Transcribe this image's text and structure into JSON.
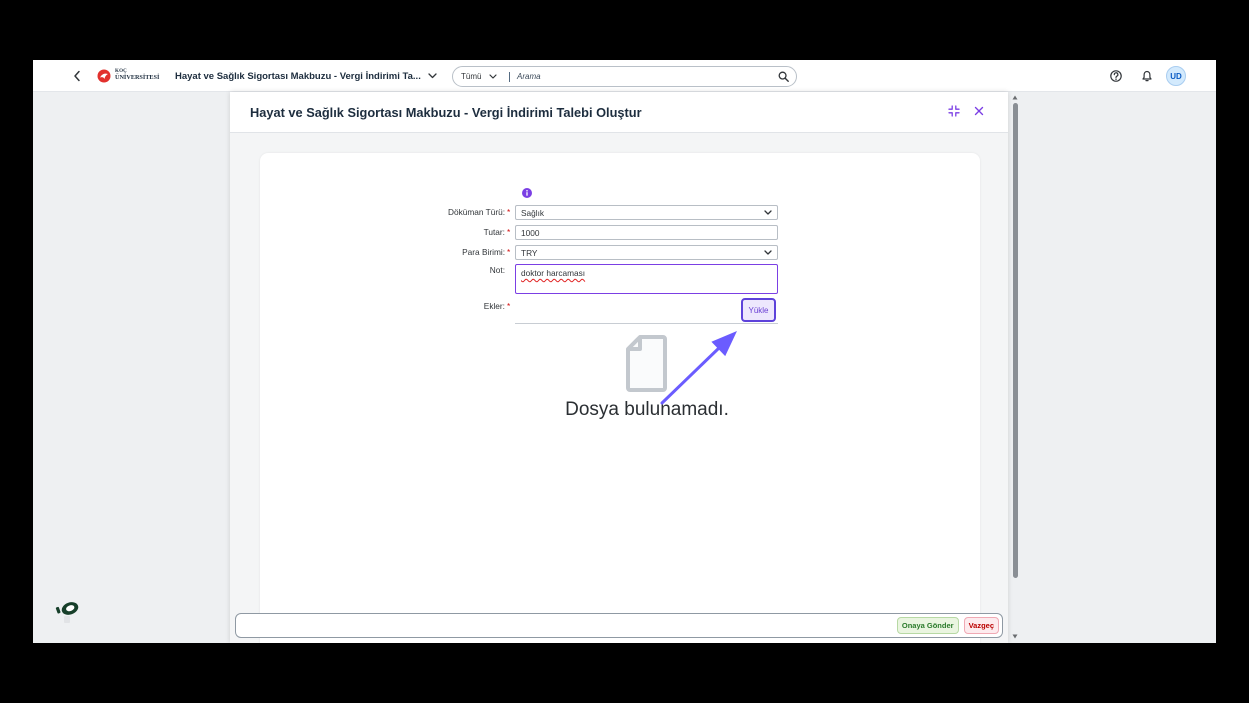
{
  "shell": {
    "logo": {
      "line1": "KOÇ",
      "line2": "ÜNİVERSİTESİ"
    },
    "app_title": "Hayat ve Sağlık Sigortası Makbuzu - Vergi İndirimi Ta...",
    "search": {
      "scope": "Tümü",
      "placeholder": "Arama"
    },
    "user_initials": "UD",
    "icons": {
      "back": "chevron-left-icon",
      "title_menu": "chevron-down-icon",
      "scope_menu": "chevron-down-icon",
      "search": "search-icon",
      "help": "help-icon",
      "notifications": "bell-icon"
    }
  },
  "dialog": {
    "title": "Hayat ve Sağlık Sigortası Makbuzu - Vergi İndirimi Talebi Oluştur",
    "icons": {
      "fullscreen": "exit-fullscreen-icon",
      "close": "close-icon",
      "info": "info-icon",
      "empty": "document-icon"
    },
    "form": {
      "required_mark": "*",
      "document_type": {
        "label": "Döküman Türü:",
        "value": "Sağlık",
        "required": true
      },
      "amount": {
        "label": "Tutar:",
        "value": "1000",
        "required": true
      },
      "currency": {
        "label": "Para Birimi:",
        "value": "TRY",
        "required": true
      },
      "note": {
        "label": "Not:",
        "value": "doktor harcaması",
        "required": false
      },
      "attachments": {
        "label": "Ekler:",
        "required": true,
        "upload_label": "Yükle",
        "empty_text": "Dosya bulunamadı."
      }
    }
  },
  "footer": {
    "submit_label": "Onaya Gönder",
    "cancel_label": "Vazgeç"
  },
  "colors": {
    "accent": "#7b3fe4",
    "annotation": "#6b5cff",
    "required": "#d20a0a",
    "positive_text": "#2a7a2a",
    "positive_bg": "#eaf5e0",
    "negative_text": "#bb0000",
    "negative_bg": "#fdebee",
    "avatar_bg": "#d3eafd",
    "avatar_text": "#0a5bc4"
  }
}
